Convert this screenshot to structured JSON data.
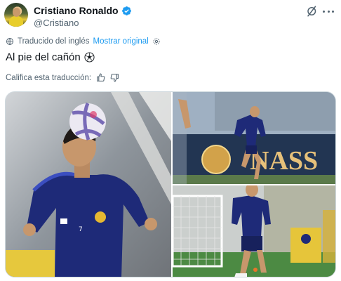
{
  "author": {
    "name": "Cristiano Ronaldo",
    "handle": "@Cristiano",
    "verified_color": "#1d9bf0"
  },
  "translation": {
    "label": "Traducido del inglés",
    "link": "Mostrar original"
  },
  "tweet": {
    "text": "Al pie del cañón"
  },
  "rating": {
    "label": "Califica esta traducción:"
  },
  "media": {
    "banner_text": "NASS"
  },
  "icons": {
    "header": [
      "grok-icon",
      "more-icon"
    ],
    "translation": [
      "globe-icon",
      "gear-icon"
    ],
    "tweet": [
      "soccer-ball-icon"
    ],
    "rating": [
      "thumbs-up-icon",
      "thumbs-down-icon"
    ]
  },
  "colors": {
    "accent": "#1d9bf0",
    "text": "#0f1419",
    "secondary": "#536471"
  }
}
